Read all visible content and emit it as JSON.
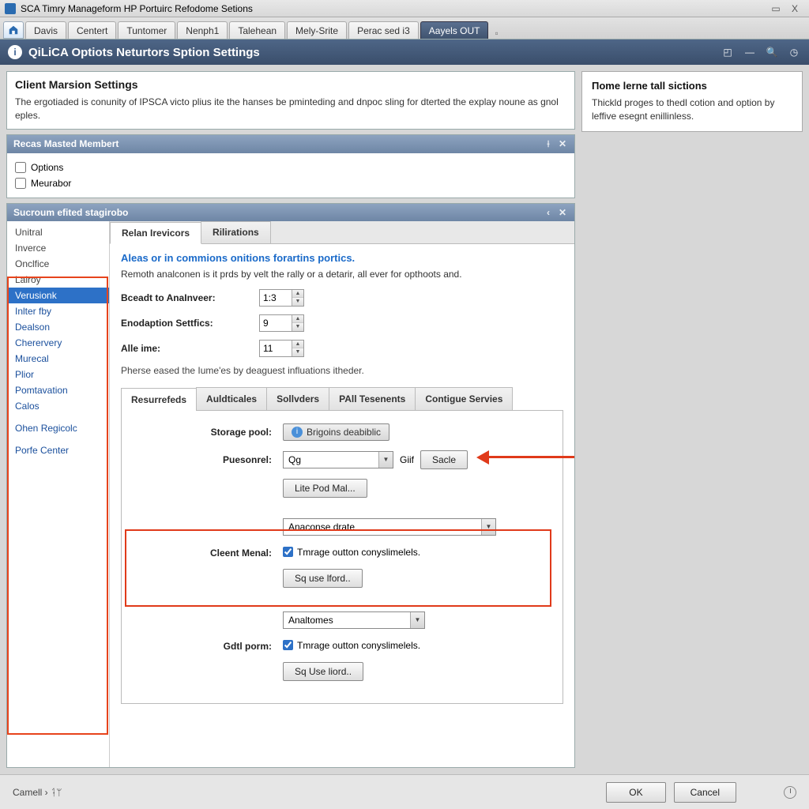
{
  "titlebar": {
    "text": "SCA Timry Manageform HP Portuirc Refodome Setions"
  },
  "tabs": {
    "items": [
      "Davis",
      "Centert",
      "Tuntomer",
      "Nenph1",
      "Talehean",
      "Mely-Srite",
      "Perac sed i3",
      "Aayels OUT"
    ],
    "active_index": 7
  },
  "bluebar": {
    "title": "QiLiCA Optiots Neturtors Sption Settings"
  },
  "top_panel": {
    "heading": "Client Marsion Settings",
    "desc": "The ergotiaded is conunity of IPSCA victo plius ite the hanses be pminteding and dnpoc sling for dterted the explay noune as gnol eples."
  },
  "member_panel": {
    "title": "Recas Masted Membert",
    "options": [
      "Options",
      "Meurabor"
    ]
  },
  "staging_panel": {
    "title": "Sucroum efited stagirobo",
    "side_items": [
      "Unitral",
      "Inverce",
      "Onclfice",
      "Lalroy",
      "Verusionk",
      "Inlter fby",
      "Dealson",
      "Cherervery",
      "Murecal",
      "Plior",
      "Pomtavation",
      "Calos",
      "Ohen Regicolc",
      "Porfe Center"
    ],
    "selected_index": 4,
    "inner_tabs": [
      "Relan Irevicors",
      "Rilirations"
    ],
    "inner_active": 0,
    "section_title": "Aleas or in commions onitions forartins portics.",
    "section_desc": "Remoth analconen is it prds by velt the rally or a detarir, all ever for opthoots and.",
    "fields": {
      "bcead_label": "Bceadt to AnaInveer:",
      "bcead_value": "1:3",
      "endo_label": "Enodaption Settfics:",
      "endo_value": "9",
      "alle_label": "Alle ime:",
      "alle_value": "11"
    },
    "note": "Pherse eased the Iume'es by deaguest influations itheder.",
    "subtabs": [
      "Resurrefeds",
      "Auldticales",
      "Sollvders",
      "PAll Tesenents",
      "Contigue Servies"
    ],
    "subtab_active": 0,
    "storage": {
      "label": "Storage pool:",
      "badge": "Brigoins deabiblic",
      "pueson_label": "Puesonrel:",
      "pueson_value": "Qg",
      "gif_label": "Giif",
      "save_label": "Sacle",
      "lite_btn": "Lite Pod Mal..."
    },
    "client_menal": {
      "label": "Cleent Menal:",
      "value": "Anaconse drate",
      "check_label": "Tmrage outton conyslimelels.",
      "btn": "Sq use lford.."
    },
    "gdl_porm": {
      "label": "Gdtl porm:",
      "value": "Analtomes",
      "check_label": "Tmrage outton conyslimelels.",
      "btn": "Sq Use liord.."
    }
  },
  "help_panel": {
    "title": "Пome lerne tall sictions",
    "desc": "Thickld proges to thedl cotion and option by leffive esegnt enillinless."
  },
  "footer": {
    "crumb": "Camell  ›  ᛑᛘ",
    "ok": "OK",
    "cancel": "Cancel"
  }
}
